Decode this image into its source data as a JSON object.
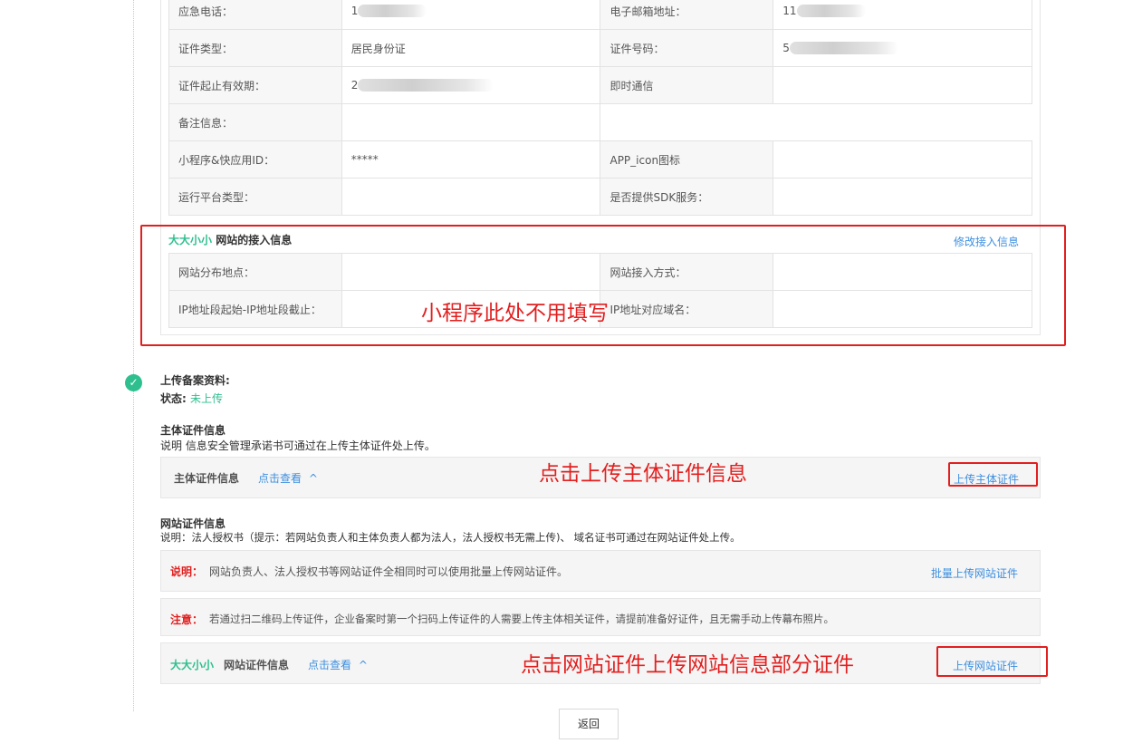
{
  "contact_table": {
    "rows": [
      [
        "应急电话：",
        "1",
        "电子邮箱地址：",
        "11"
      ],
      [
        "证件类型：",
        "居民身份证",
        "证件号码：",
        "5"
      ],
      [
        "证件起止有效期：",
        "2",
        "即时通信",
        ""
      ],
      [
        "备注信息：",
        "",
        "",
        ""
      ],
      [
        "小程序&快应用ID：",
        "*****",
        "APP_icon图标",
        ""
      ],
      [
        "运行平台类型：",
        "",
        "是否提供SDK服务：",
        ""
      ]
    ]
  },
  "access_section": {
    "site_name": "大大小小",
    "title": "网站的接入信息",
    "edit_link": "修改接入信息",
    "rows": [
      [
        "网站分布地点：",
        "",
        "网站接入方式：",
        ""
      ],
      [
        "IP地址段起始-IP地址段截止：",
        "",
        "IP地址对应域名：",
        ""
      ]
    ]
  },
  "annotations": {
    "mini_program": "小程序此处不用填写",
    "upload_subject": "点击上传主体证件信息",
    "upload_site": "点击网站证件上传网站信息部分证件"
  },
  "upload": {
    "title": "上传备案资料:",
    "status_label": "状态:",
    "status_value": "未上传",
    "check_icon": "✓"
  },
  "subject_cert": {
    "title": "主体证件信息",
    "desc": "说明 信息安全管理承诺书可通过在上传主体证件处上传。",
    "panel_label": "主体证件信息",
    "view_link": "点击查看",
    "chevron": "^",
    "upload_link": "上传主体证件"
  },
  "site_cert": {
    "title": "网站证件信息",
    "desc": "说明：法人授权书（提示：若网站负责人和主体负责人都为法人，法人授权书无需上传)、 域名证书可通过在网站证件处上传。",
    "note_label": "说明：",
    "note_text": "网站负责人、法人授权书等网站证件全相同时可以使用批量上传网站证件。",
    "batch_link": "批量上传网站证件",
    "warn_label": "注意：",
    "warn_text": "若通过扫二维码上传证件，企业备案时第一个扫码上传证件的人需要上传主体相关证件，请提前准备好证件，且无需手动上传幕布照片。",
    "site_name": "大大小小",
    "panel_label": "网站证件信息",
    "view_link": "点击查看",
    "chevron": "^",
    "upload_link": "上传网站证件"
  },
  "back_button": "返回",
  "colors": {
    "accent_green": "#2fbf8f",
    "link_blue": "#3d8fe0",
    "annotation_red": "#e21f1f"
  }
}
